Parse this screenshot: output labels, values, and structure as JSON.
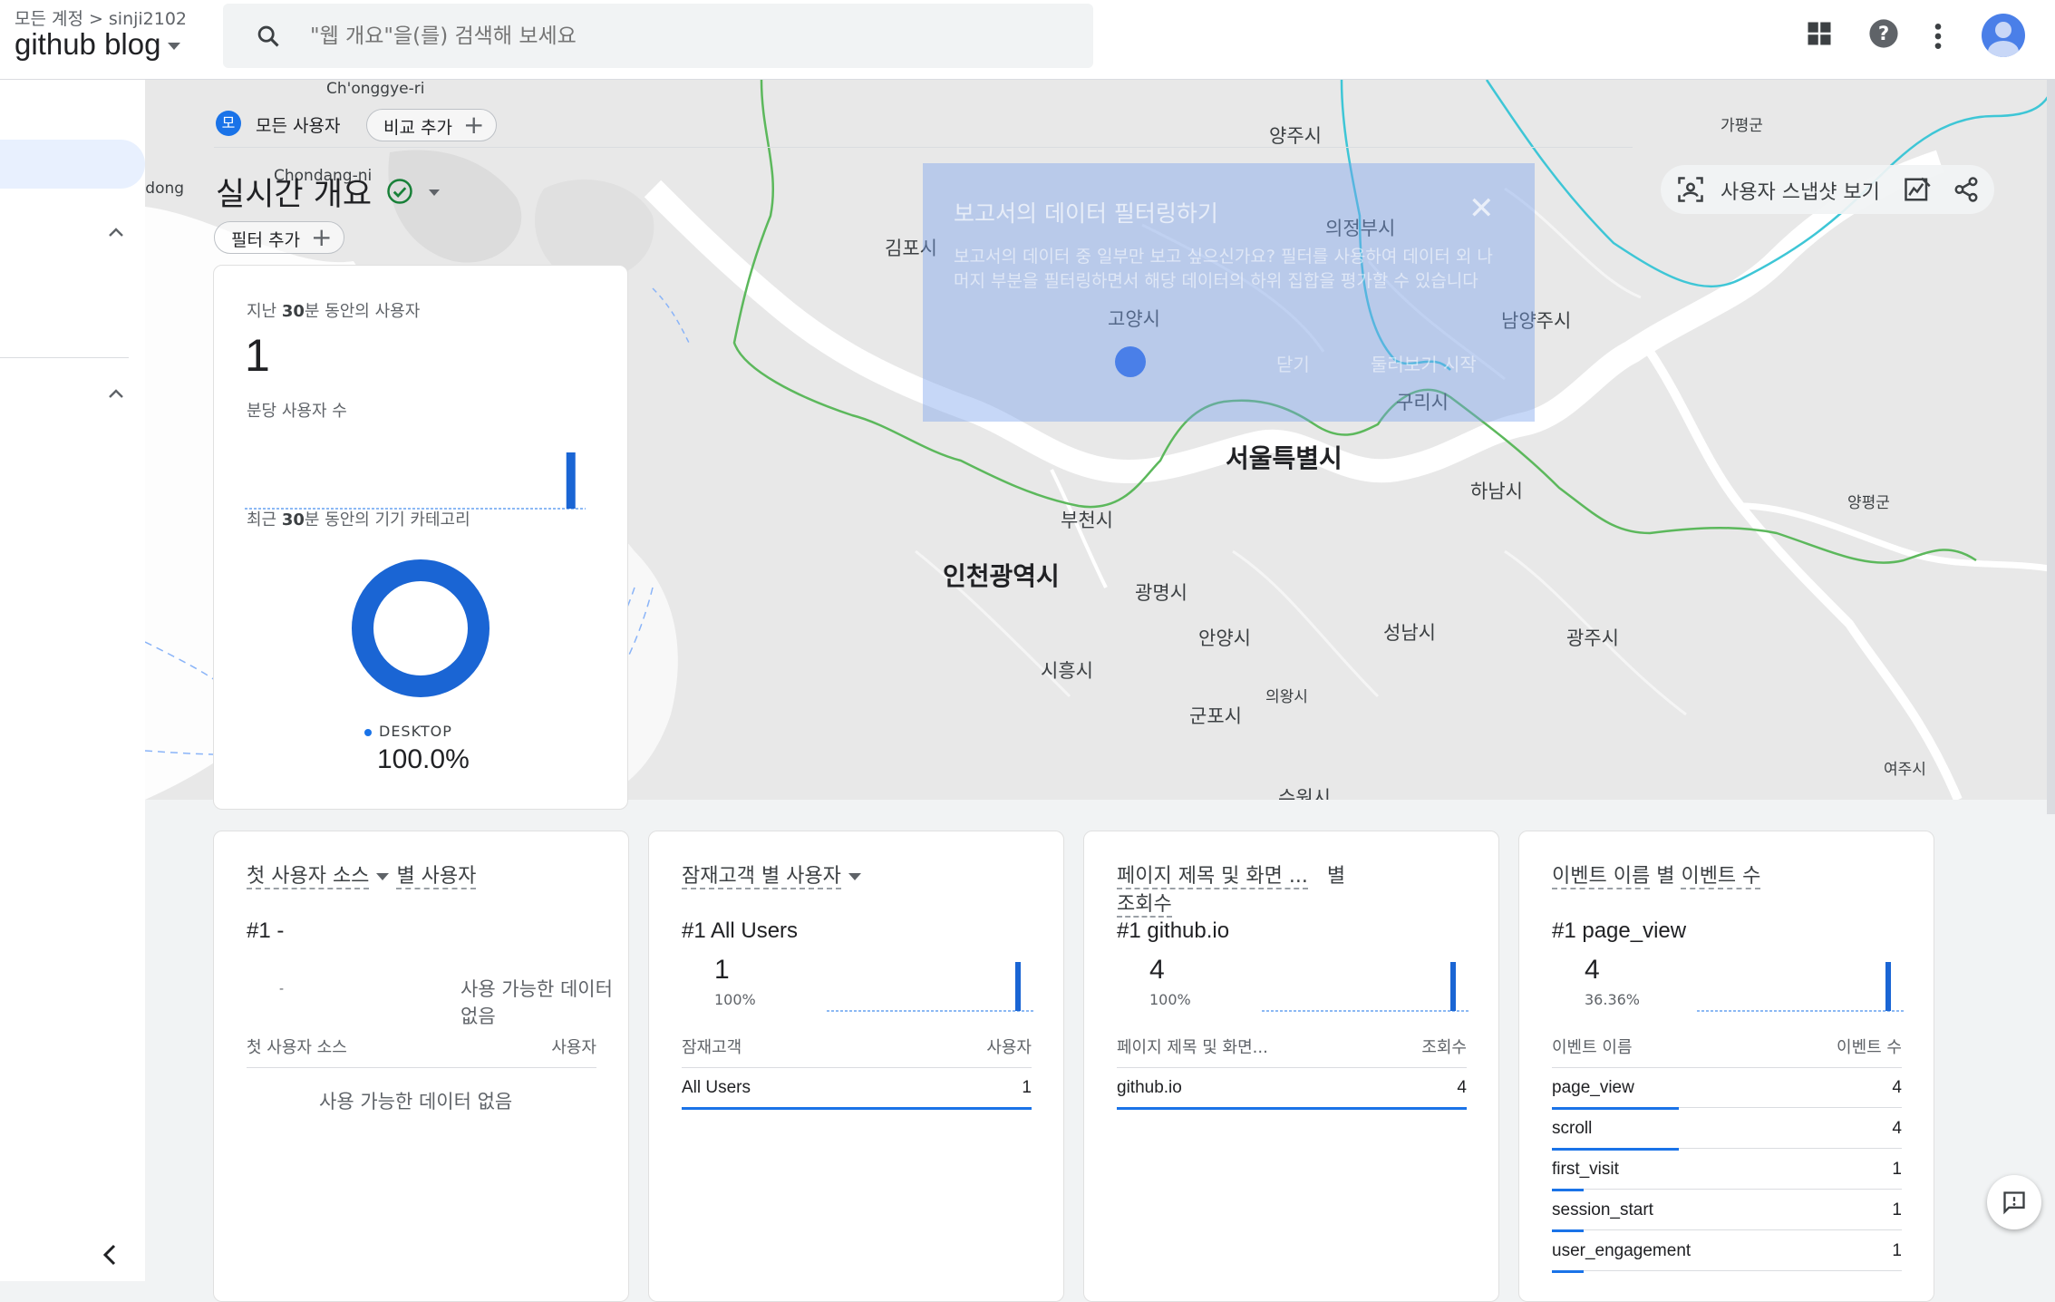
{
  "header": {
    "breadcrumb_root": "모든 계정",
    "breadcrumb_account": "sinji2102",
    "property": "github blog",
    "search_placeholder": "\"웹 개요\"을(를) 검색해 보세요"
  },
  "map": {
    "cities": [
      "Ch'onggye-ri",
      "양주시",
      "가평군",
      "On-dong",
      "Chondang-ni",
      "의정부시",
      "김포시",
      "고양시",
      "남양주시",
      "구리시",
      "서울특별시",
      "하남시",
      "양평군",
      "부천시",
      "인천광역시",
      "광명시",
      "안양시",
      "성남시",
      "광주시",
      "시흥시",
      "의왕시",
      "군포시",
      "수원시",
      "여주시"
    ],
    "overlay": {
      "title": "보고서의 데이터 필터링하기",
      "desc": "보고서의 데이터 중 일부만 보고 싶으신가요? 필터를 사용하여 데이터 외 나머지 부분을 필터링하면서 해당 데이터의 하위 집합을 평가할 수 있습니다",
      "close": "✕",
      "btn_dismiss": "닫기",
      "btn_start": "둘러보기 시작"
    }
  },
  "toolbar": {
    "segment_marker": "모",
    "segment_label": "모든 사용자",
    "compare_label": "비교 추가",
    "title": "실시간 개요",
    "filter_label": "필터 추가",
    "snapshot_label": "사용자 스냅샷 보기"
  },
  "realtime": {
    "users_label_a": "지난 ",
    "users_label_b": "30",
    "users_label_c": "분 동안의 사용자",
    "users_value": "1",
    "per_minute_label": "분당 사용자 수",
    "per_minute_bars": [
      0,
      0,
      0,
      0,
      0,
      0,
      0,
      0,
      0,
      0,
      0,
      0,
      0,
      0,
      0,
      0,
      0,
      0,
      0,
      0,
      0,
      0,
      0,
      0,
      0,
      0,
      0,
      0,
      0,
      1
    ],
    "device_label_a": "최근 ",
    "device_label_b": "30",
    "device_label_c": "분 동안의 기기 카테고리",
    "device_legend": "DESKTOP",
    "device_pct": "100.0%",
    "device_share": 1.0
  },
  "cards": [
    {
      "title_pre": "첫 사용자 소스",
      "title_post": "별 사용자",
      "top": "#1  -",
      "empty_top": "사용 가능한 데이터 없음",
      "dash": "-",
      "col1": "첫 사용자 소스",
      "col2": "사용자",
      "empty": "사용 가능한 데이터 없음"
    },
    {
      "title_pre": "잠재고객 별 사용자",
      "top": "#1  All Users",
      "value": "1",
      "pct": "100%",
      "col1": "잠재고객",
      "col2": "사용자",
      "rows": [
        {
          "name": "All Users",
          "value": "1",
          "share": 1.0
        }
      ]
    },
    {
      "title_line1": "페이지 제목 및 화면 ...",
      "title_line1b": "별",
      "title_line2": "조회수",
      "top": "#1  github.io",
      "value": "4",
      "pct": "100%",
      "col1": "페이지 제목 및 화면...",
      "col2": "조회수",
      "rows": [
        {
          "name": "github.io",
          "value": "4",
          "share": 1.0
        }
      ]
    },
    {
      "title_pre": "이벤트 이름",
      "title_mid": "별",
      "title_post": "이벤트 수",
      "top": "#1  page_view",
      "value": "4",
      "pct": "36.36%",
      "col1": "이벤트 이름",
      "col2": "이벤트 수",
      "rows": [
        {
          "name": "page_view",
          "value": "4",
          "share": 0.3636
        },
        {
          "name": "scroll",
          "value": "4",
          "share": 0.3636
        },
        {
          "name": "first_visit",
          "value": "1",
          "share": 0.0909
        },
        {
          "name": "session_start",
          "value": "1",
          "share": 0.0909
        },
        {
          "name": "user_engagement",
          "value": "1",
          "share": 0.0909
        }
      ]
    }
  ],
  "colors": {
    "accent": "#1a73e8",
    "map_land": "#eeeeee",
    "map_water": "#ffffff",
    "border_green": "#5cb85c",
    "border_cyan": "#3ec6d6"
  }
}
